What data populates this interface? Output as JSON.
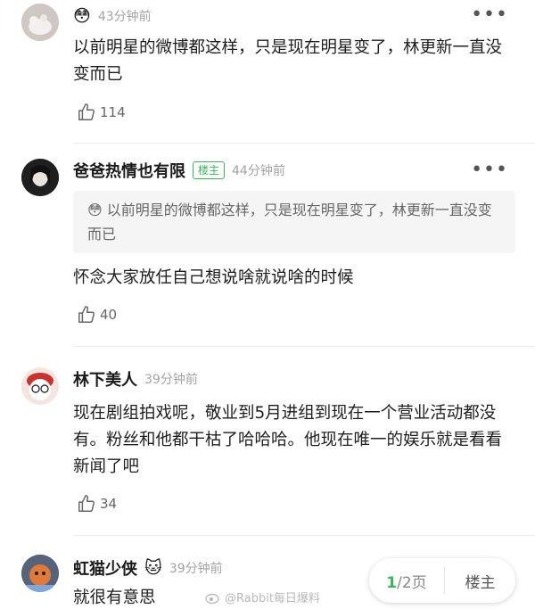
{
  "comments": [
    {
      "emoji": "😳",
      "time": "43分钟前",
      "text": "以前明星的微博都这样，只是现在明星变了，林更新一直没变而已",
      "likes": "114"
    },
    {
      "name": "爸爸热情也有限",
      "badge": "楼主",
      "time": "44分钟前",
      "quote_emoji": "😳",
      "quote": "以前明星的微博都这样，只是现在明星变了，林更新一直没变而已",
      "text": "怀念大家放任自己想说啥就说啥的时候",
      "likes": "40"
    },
    {
      "name": "林下美人",
      "time": "39分钟前",
      "text": "现在剧组拍戏呢，敬业到5月进组到现在一个营业活动都没有。粉丝和他都干枯了哈哈哈。他现在唯一的娱乐就是看看新闻了吧",
      "likes": "34"
    },
    {
      "name": "虹猫少侠",
      "emoji": "🐱",
      "time": "39分钟前",
      "text": "就很有意思"
    }
  ],
  "pager": {
    "current": "1",
    "total": "/2页",
    "op_label": "楼主"
  },
  "watermark": "@Rabbit每日爆料",
  "colors": {
    "accent": "#3ab55a",
    "time": "#a3a3a3",
    "quote_bg": "#f5f5f5"
  },
  "icons": {
    "more": "more-dots-icon",
    "like": "thumb-up-icon"
  }
}
